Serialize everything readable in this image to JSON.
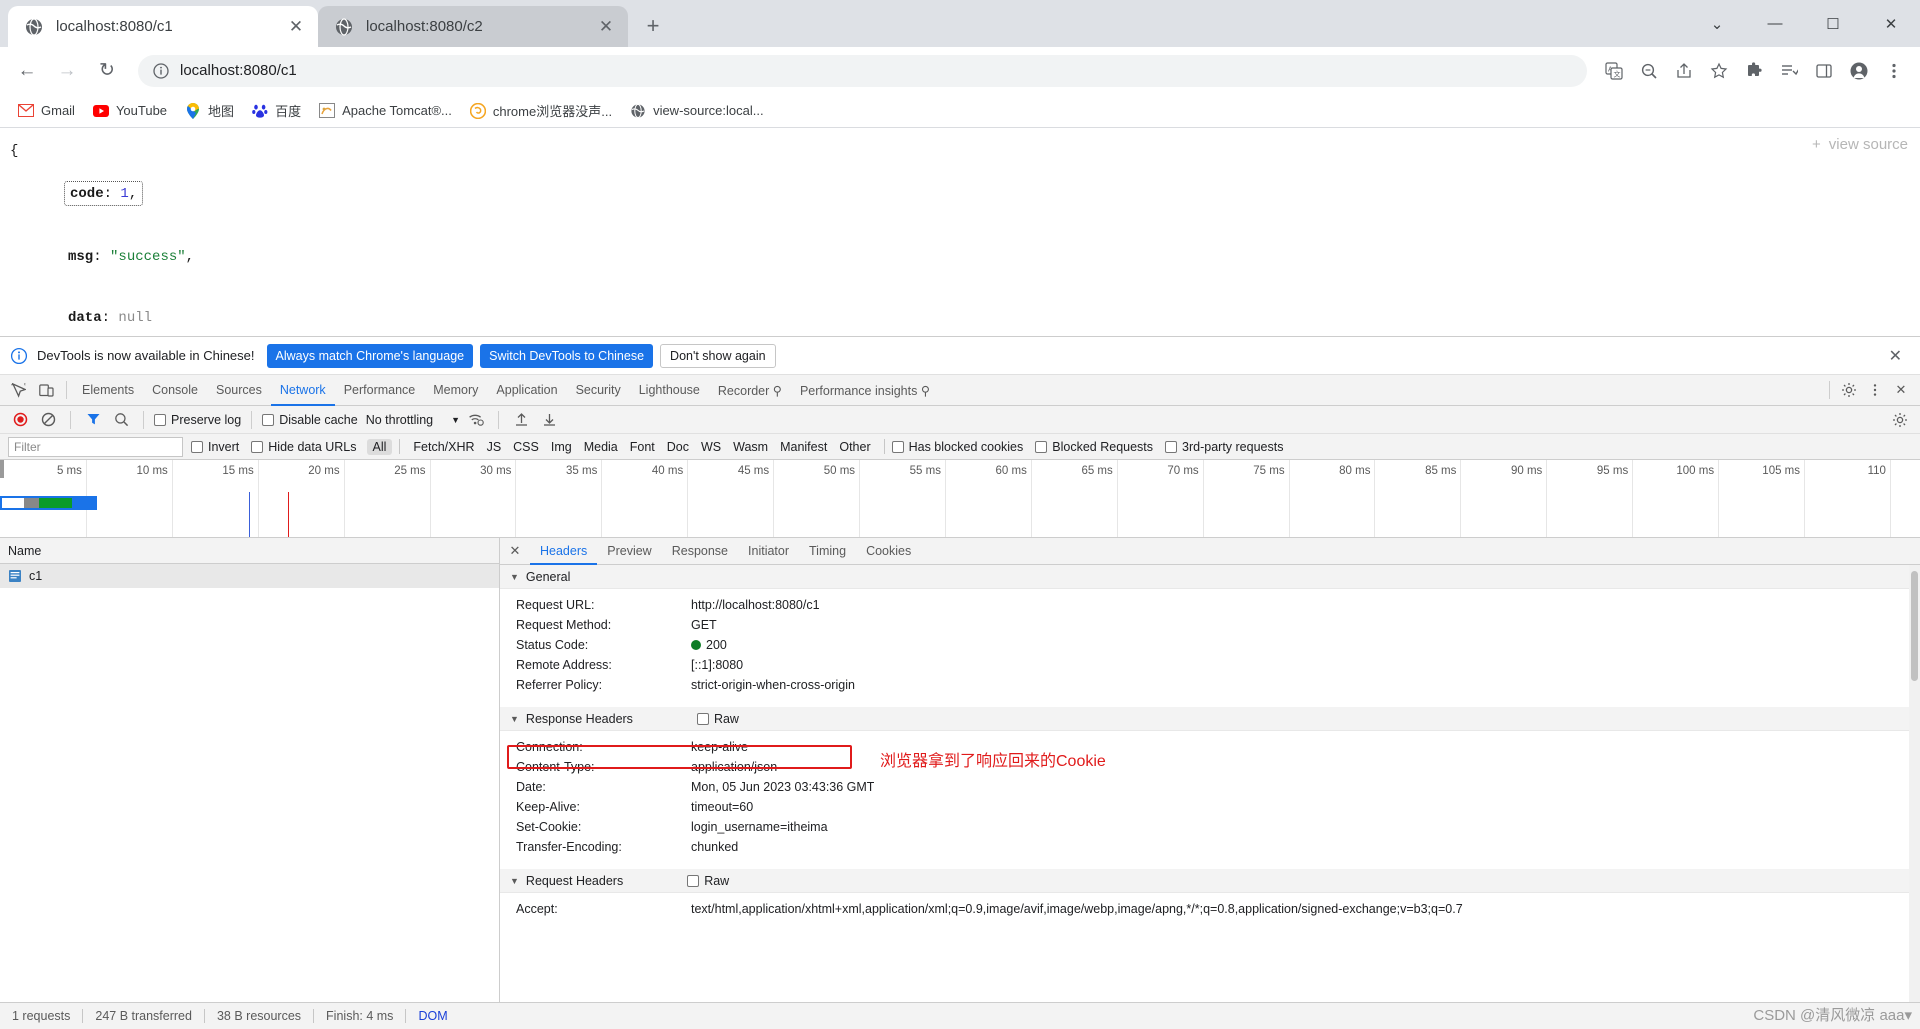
{
  "browser": {
    "tabs": [
      {
        "title": "localhost:8080/c1",
        "active": true
      },
      {
        "title": "localhost:8080/c2",
        "active": false
      }
    ],
    "newtab_label": "+",
    "window_controls": {
      "minimize": "—",
      "maximize": "☐",
      "close": "✕",
      "chevron": "⌄"
    },
    "nav": {
      "back": "←",
      "forward": "→",
      "reload": "↻"
    },
    "omnibox": {
      "url": "localhost:8080/c1",
      "info_icon": "info-circle"
    },
    "toolbar_icons": [
      "translate-icon",
      "zoom-icon",
      "share-icon",
      "star-icon",
      "extensions-icon",
      "reading-list-icon",
      "side-panel-icon",
      "profile-icon",
      "menu-icon"
    ],
    "bookmarks": [
      {
        "label": "Gmail",
        "icon": "gmail"
      },
      {
        "label": "YouTube",
        "icon": "youtube"
      },
      {
        "label": "地图",
        "icon": "maps"
      },
      {
        "label": "百度",
        "icon": "baidu"
      },
      {
        "label": "Apache Tomcat®...",
        "icon": "tomcat"
      },
      {
        "label": "chrome浏览器没声...",
        "icon": "chrome-orange"
      },
      {
        "label": "view-source:local...",
        "icon": "globe"
      }
    ]
  },
  "page": {
    "view_source_label": "view source",
    "view_source_plus": "+",
    "json": {
      "open_brace": "{",
      "close_brace": "}",
      "lines": [
        {
          "key": "code",
          "value": "1",
          "type": "num",
          "comma": ",",
          "boxed": true
        },
        {
          "key": "msg",
          "value": "\"success\"",
          "type": "str",
          "comma": ",",
          "boxed": false
        },
        {
          "key": "data",
          "value": "null",
          "type": "null",
          "comma": "",
          "boxed": false
        }
      ]
    }
  },
  "devtools": {
    "infobar": {
      "message": "DevTools is now available in Chinese!",
      "btn_always": "Always match Chrome's language",
      "btn_switch": "Switch DevTools to Chinese",
      "btn_dismiss": "Don't show again",
      "close": "✕"
    },
    "tabs": [
      {
        "label": "Elements",
        "sel": false
      },
      {
        "label": "Console",
        "sel": false
      },
      {
        "label": "Sources",
        "sel": false
      },
      {
        "label": "Network",
        "sel": true
      },
      {
        "label": "Performance",
        "sel": false
      },
      {
        "label": "Memory",
        "sel": false
      },
      {
        "label": "Application",
        "sel": false
      },
      {
        "label": "Security",
        "sel": false
      },
      {
        "label": "Lighthouse",
        "sel": false
      },
      {
        "label": "Recorder ⚲",
        "sel": false
      },
      {
        "label": "Performance insights ⚲",
        "sel": false
      }
    ],
    "network_toolbar": {
      "record": "record-icon",
      "clear": "clear-icon",
      "filter": "filter-icon",
      "search": "search-icon",
      "preserve_log": "Preserve log",
      "disable_cache": "Disable cache",
      "throttling": "No throttling",
      "throttling_caret": "▼",
      "wifi": "network-conditions-icon",
      "import": "import-har-icon",
      "export": "export-har-icon",
      "settings": "settings-icon",
      "more": "more-icon"
    },
    "filter_bar": {
      "filter_placeholder": "Filter",
      "invert": "Invert",
      "hide_data_urls": "Hide data URLs",
      "types": [
        "All",
        "Fetch/XHR",
        "JS",
        "CSS",
        "Img",
        "Media",
        "Font",
        "Doc",
        "WS",
        "Wasm",
        "Manifest",
        "Other"
      ],
      "selected_type": "All",
      "has_blocked_cookies": "Has blocked cookies",
      "blocked_requests": "Blocked Requests",
      "third_party": "3rd-party requests"
    },
    "overview_ticks": [
      "5 ms",
      "10 ms",
      "15 ms",
      "20 ms",
      "25 ms",
      "30 ms",
      "35 ms",
      "40 ms",
      "45 ms",
      "50 ms",
      "55 ms",
      "60 ms",
      "65 ms",
      "70 ms",
      "75 ms",
      "80 ms",
      "85 ms",
      "90 ms",
      "95 ms",
      "100 ms",
      "105 ms",
      "110"
    ],
    "request_list": {
      "header": "Name",
      "rows": [
        {
          "name": "c1",
          "icon": "document-icon"
        }
      ]
    },
    "details": {
      "close": "✕",
      "tabs": [
        {
          "label": "Headers",
          "sel": true
        },
        {
          "label": "Preview",
          "sel": false
        },
        {
          "label": "Response",
          "sel": false
        },
        {
          "label": "Initiator",
          "sel": false
        },
        {
          "label": "Timing",
          "sel": false
        },
        {
          "label": "Cookies",
          "sel": false
        }
      ],
      "sections": [
        {
          "title": "General",
          "raw": null,
          "rows": [
            {
              "k": "Request URL:",
              "v": "http://localhost:8080/c1"
            },
            {
              "k": "Request Method:",
              "v": "GET"
            },
            {
              "k": "Status Code:",
              "v": "200",
              "status": true
            },
            {
              "k": "Remote Address:",
              "v": "[::1]:8080"
            },
            {
              "k": "Referrer Policy:",
              "v": "strict-origin-when-cross-origin"
            }
          ]
        },
        {
          "title": "Response Headers",
          "raw": "Raw",
          "rows": [
            {
              "k": "Connection:",
              "v": "keep-alive"
            },
            {
              "k": "Content-Type:",
              "v": "application/json"
            },
            {
              "k": "Date:",
              "v": "Mon, 05 Jun 2023 03:43:36 GMT"
            },
            {
              "k": "Keep-Alive:",
              "v": "timeout=60"
            },
            {
              "k": "Set-Cookie:",
              "v": "login_username=itheima",
              "highlight": true
            },
            {
              "k": "Transfer-Encoding:",
              "v": "chunked"
            }
          ]
        },
        {
          "title": "Request Headers",
          "raw": "Raw",
          "rows": [
            {
              "k": "Accept:",
              "v": "text/html,application/xhtml+xml,application/xml;q=0.9,image/avif,image/webp,image/apng,*/*;q=0.8,application/signed-exchange;v=b3;q=0.7"
            }
          ]
        }
      ],
      "annotation": "浏览器拿到了响应回来的Cookie"
    },
    "statusbar": {
      "requests": "1 requests",
      "transferred": "247 B transferred",
      "resources": "38 B resources",
      "finish": "Finish: 4 ms",
      "dom": "DOM"
    }
  },
  "watermark": "CSDN @清风微凉 aaa▾",
  "colors": {
    "accent": "#1a73e8",
    "tab_active_bg": "#ffffff",
    "tab_inactive_bg": "#c9ccd1",
    "chrome_frame": "#dee1e6",
    "status_ok": "#0d7d26",
    "annotation_red": "#e01b1b"
  }
}
